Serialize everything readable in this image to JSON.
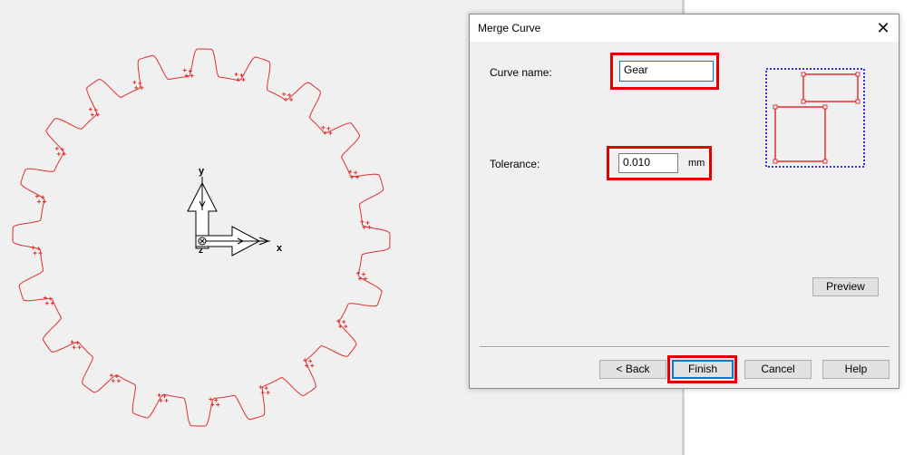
{
  "colors": {
    "curve": "#e03030",
    "accent": "#0078d7",
    "highlight": "#e00000"
  },
  "canvas": {
    "axes": {
      "x_label": "x",
      "y_label": "y",
      "z_label": "z"
    }
  },
  "dialog": {
    "title": "Merge Curve",
    "close_icon": "close-icon",
    "curve_name": {
      "label": "Curve name:",
      "value": "Gear"
    },
    "tolerance": {
      "label": "Tolerance:",
      "value": "0.010",
      "unit": "mm"
    },
    "preview_button": "Preview",
    "buttons": {
      "back": "< Back",
      "finish": "Finish",
      "cancel": "Cancel",
      "help": "Help"
    },
    "preview_icon": "merge-rectangles-icon"
  }
}
